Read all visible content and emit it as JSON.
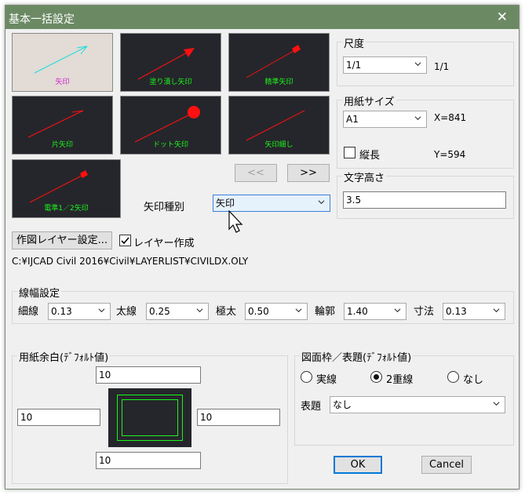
{
  "window": {
    "title": "基本一括設定"
  },
  "arrow_tiles": [
    {
      "label": "矢印"
    },
    {
      "label": "塗り潰し矢印"
    },
    {
      "label": "精準矢印"
    },
    {
      "label": "片矢印"
    },
    {
      "label": "ドット矢印"
    },
    {
      "label": "矢印細し"
    },
    {
      "label": "電準1／2矢印"
    }
  ],
  "nav": {
    "prev": "<<",
    "next": ">>"
  },
  "arrow_type": {
    "label": "矢印種別",
    "value": "矢印"
  },
  "layer": {
    "settings_button": "作図レイヤー設定...",
    "create_label": "レイヤー作成",
    "path": "C:¥IJCAD Civil 2016¥Civil¥LAYERLIST¥CIVILDX.OLY"
  },
  "scale": {
    "group": "尺度",
    "value": "1/1",
    "readout": "1/1"
  },
  "paper_size": {
    "group": "用紙サイズ",
    "value": "A1",
    "x_readout": "X=841",
    "portrait_label": "縦長",
    "y_readout": "Y=594"
  },
  "text_height": {
    "group": "文字高さ",
    "value": "3.5"
  },
  "line_width": {
    "group": "線幅設定",
    "fields": [
      {
        "label": "細線",
        "value": "0.13"
      },
      {
        "label": "太線",
        "value": "0.25"
      },
      {
        "label": "極太",
        "value": "0.50"
      },
      {
        "label": "輪郭",
        "value": "1.40"
      },
      {
        "label": "寸法",
        "value": "0.13"
      }
    ]
  },
  "margins": {
    "group": "用紙余白(ﾃﾞﾌｫﾙﾄ値)",
    "top": "10",
    "left": "10",
    "right": "10",
    "bottom": "10"
  },
  "frame": {
    "group": "図面枠／表題(ﾃﾞﾌｫﾙﾄ値)",
    "options": [
      "実線",
      "2重線",
      "なし"
    ],
    "selected": "2重線",
    "title_label": "表題",
    "title_value": "なし"
  },
  "buttons": {
    "ok": "OK",
    "cancel": "Cancel"
  }
}
